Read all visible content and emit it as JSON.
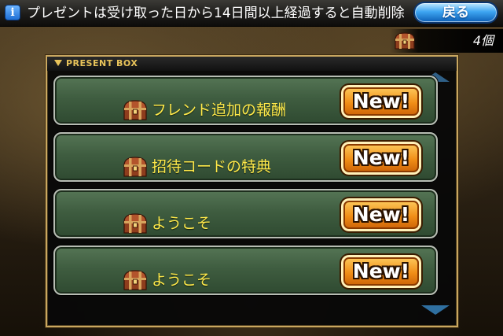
{
  "top_bar": {
    "info_icon": "info-icon",
    "info_glyph": "i",
    "notice_text": "プレゼントは受け取った日から14日間以上経過すると自動削除",
    "back_label": "戻る"
  },
  "inventory": {
    "chest_icon": "treasure-chest-icon",
    "count": "4個"
  },
  "present_box": {
    "title": "PRESENT BOX",
    "items": [
      {
        "label": "フレンド追加の報酬",
        "badge": "New!",
        "icon": "treasure-chest-icon"
      },
      {
        "label": "招待コードの特典",
        "badge": "New!",
        "icon": "treasure-chest-icon"
      },
      {
        "label": "ようこそ",
        "badge": "New!",
        "icon": "treasure-chest-icon"
      },
      {
        "label": "ようこそ",
        "badge": "New!",
        "icon": "treasure-chest-icon"
      }
    ]
  },
  "colors": {
    "item_label": "#ffe94a",
    "item_background": "#3f5d40",
    "badge_orange": "#f08d16",
    "title_gold": "#e8c35a",
    "back_button_blue": "#3fa6f2"
  }
}
